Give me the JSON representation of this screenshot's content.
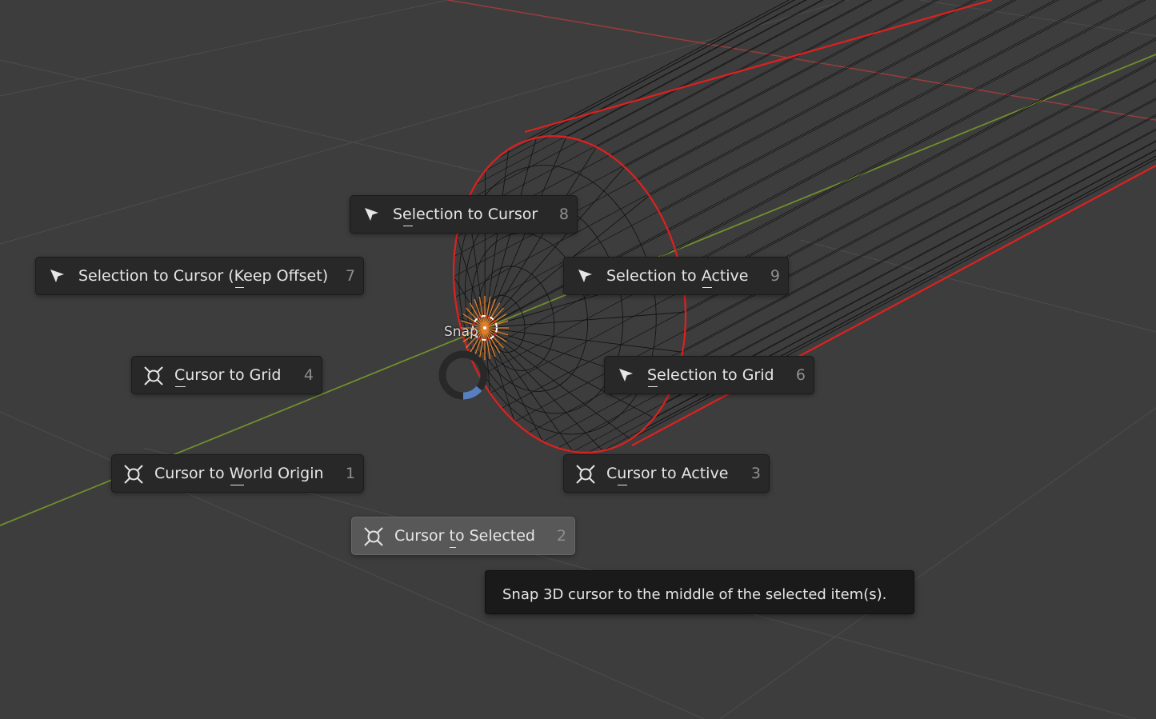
{
  "pie_menu": {
    "title": "Snap",
    "items": [
      {
        "id": "selection-to-cursor",
        "label": "Selection to Cursor",
        "key": "8",
        "icon": "cursor-arrow-icon",
        "mnemonic": "e"
      },
      {
        "id": "selection-to-cursor-keep-offset",
        "label": "Selection to Cursor (Keep Offset)",
        "key": "7",
        "icon": "cursor-arrow-icon",
        "mnemonic": "K"
      },
      {
        "id": "selection-to-active",
        "label": "Selection to Active",
        "key": "9",
        "icon": "cursor-arrow-icon",
        "mnemonic": "A"
      },
      {
        "id": "cursor-to-grid",
        "label": "Cursor to Grid",
        "key": "4",
        "icon": "3d-cursor-icon",
        "mnemonic": "C"
      },
      {
        "id": "selection-to-grid",
        "label": "Selection to Grid",
        "key": "6",
        "icon": "cursor-arrow-icon",
        "mnemonic": "S"
      },
      {
        "id": "cursor-to-world-origin",
        "label": "Cursor to World Origin",
        "key": "1",
        "icon": "3d-cursor-icon",
        "mnemonic": "W"
      },
      {
        "id": "cursor-to-active",
        "label": "Cursor to Active",
        "key": "3",
        "icon": "3d-cursor-icon",
        "mnemonic": "u"
      },
      {
        "id": "cursor-to-selected",
        "label": "Cursor to Selected",
        "key": "2",
        "icon": "3d-cursor-icon",
        "mnemonic": "t",
        "active": true
      }
    ]
  },
  "tooltip": {
    "text": "Snap 3D cursor to the middle of the selected item(s)."
  },
  "colors": {
    "viewport_bg": "#3d3d3d",
    "grid_line": "#4a4a4a",
    "x_axis": "#9a3c3c",
    "y_axis": "#6f8f2d",
    "wire": "#111111",
    "selected_edge": "#e0201e",
    "pie_item_bg": "#282828",
    "pie_item_active_bg": "#585858",
    "direction_indicator": "#5680c2",
    "cursor_orange": "#e0802a"
  }
}
